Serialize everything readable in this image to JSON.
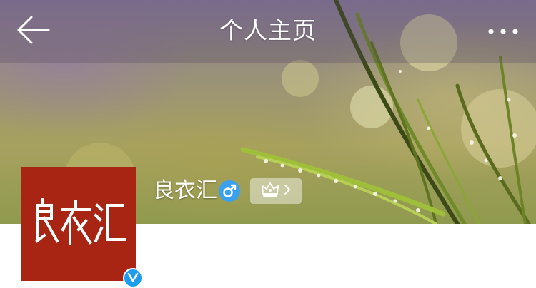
{
  "navbar": {
    "title": "个人主页",
    "back_icon": "back-arrow-icon",
    "more_icon": "more-dots-icon"
  },
  "profile": {
    "username": "良衣汇",
    "gender": "male",
    "gender_icon": "male-gender-icon",
    "verified": true,
    "verified_badge_icon": "verified-v-icon",
    "vip_icon": "crown-icon",
    "vip_chevron_icon": "chevron-right-icon",
    "avatar": {
      "logo_text": "良衣汇",
      "background_color": "#a82514",
      "text_color": "#ffffff"
    }
  },
  "colors": {
    "verified_blue": "#1e9cf0",
    "gender_blue": "#3aa0f0",
    "white": "#ffffff"
  }
}
